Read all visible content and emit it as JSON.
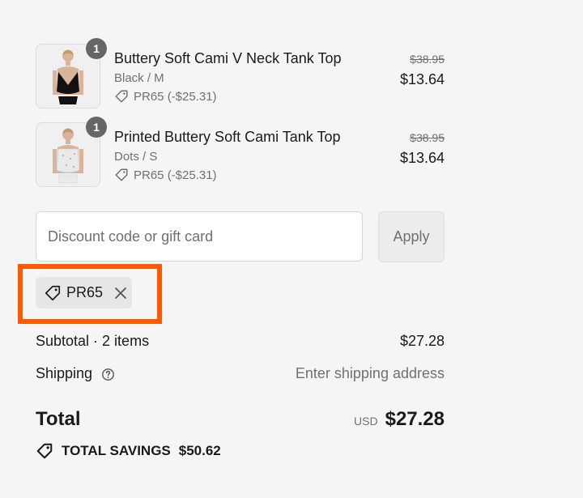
{
  "line_items": [
    {
      "quantity": "1",
      "name": "Buttery Soft Cami V Neck Tank Top",
      "variant": "Black / M",
      "discount": "PR65 (-$25.31)",
      "original_price": "$38.95",
      "price": "$13.64",
      "product_color": "#111111"
    },
    {
      "quantity": "1",
      "name": "Printed Buttery Soft Cami Tank Top",
      "variant": "Dots / S",
      "discount": "PR65 (-$25.31)",
      "original_price": "$38.95",
      "price": "$13.64",
      "product_color": "#eaeaea"
    }
  ],
  "discount_form": {
    "placeholder": "Discount code or gift card",
    "value": "",
    "apply_label": "Apply"
  },
  "applied_code": {
    "code": "PR65"
  },
  "summary": {
    "subtotal_label": "Subtotal · 2 items",
    "subtotal_value": "$27.28",
    "shipping_label": "Shipping",
    "shipping_value": "Enter shipping address",
    "total_label": "Total",
    "currency": "USD",
    "total_value": "$27.28",
    "savings_label": "TOTAL SAVINGS",
    "savings_value": "$50.62"
  },
  "icons": {
    "tag": "tag-icon",
    "close": "close-icon",
    "help": "help-circle-icon",
    "savings": "savings-tag-icon"
  },
  "colors": {
    "highlight": "#ff5a00",
    "background": "#f5f5f5",
    "muted_text": "#707070",
    "quantity_badge": "#666666"
  }
}
